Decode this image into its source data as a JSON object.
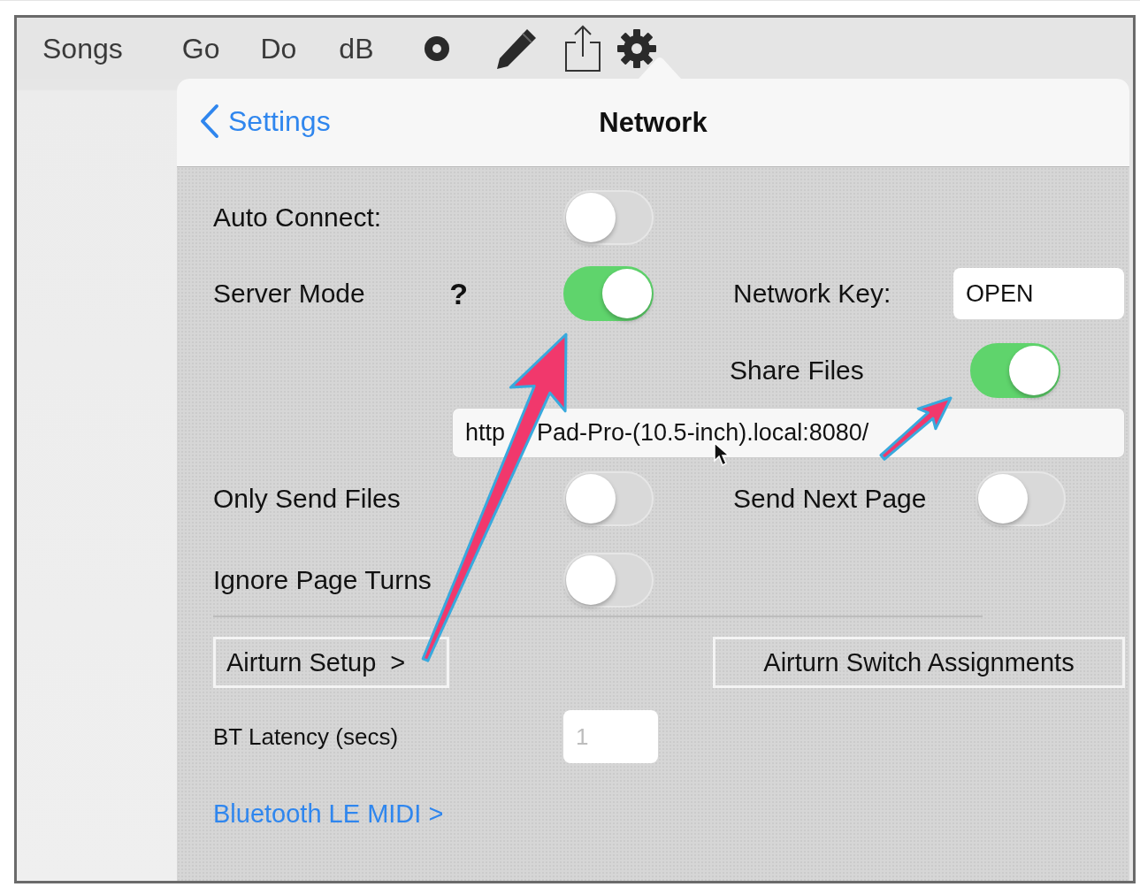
{
  "toolbar": {
    "items": [
      {
        "kind": "text",
        "label": "Songs"
      },
      {
        "kind": "text",
        "label": "Go"
      },
      {
        "kind": "text",
        "label": "Do"
      },
      {
        "kind": "text",
        "label": "dB"
      },
      {
        "kind": "record"
      },
      {
        "kind": "pencil"
      },
      {
        "kind": "share"
      },
      {
        "kind": "gear"
      }
    ]
  },
  "navigation": {
    "back": "Settings",
    "title": "Network"
  },
  "auto_connect": {
    "label": "Auto Connect:",
    "on": false
  },
  "server_mode": {
    "label": "Server Mode",
    "help": "?",
    "on": true
  },
  "network_key": {
    "label": "Network Key:",
    "value": "OPEN"
  },
  "share_files": {
    "label": "Share Files",
    "on": true
  },
  "server_url": {
    "parts": [
      "http",
      "Pad-Pro-(10.5-inch).local:8080/"
    ]
  },
  "only_send_files": {
    "label": "Only Send Files",
    "on": false
  },
  "send_next_page": {
    "label": "Send Next Page",
    "on": false
  },
  "ignore_page_turns": {
    "label": "Ignore Page Turns",
    "on": false
  },
  "buttons": [
    "Airturn Setup  >",
    "Airturn Switch Assignments"
  ],
  "bt_latency": {
    "label": "BT Latency (secs)",
    "placeholder": "1"
  },
  "bluetooth_link": "Bluetooth LE MIDI >"
}
